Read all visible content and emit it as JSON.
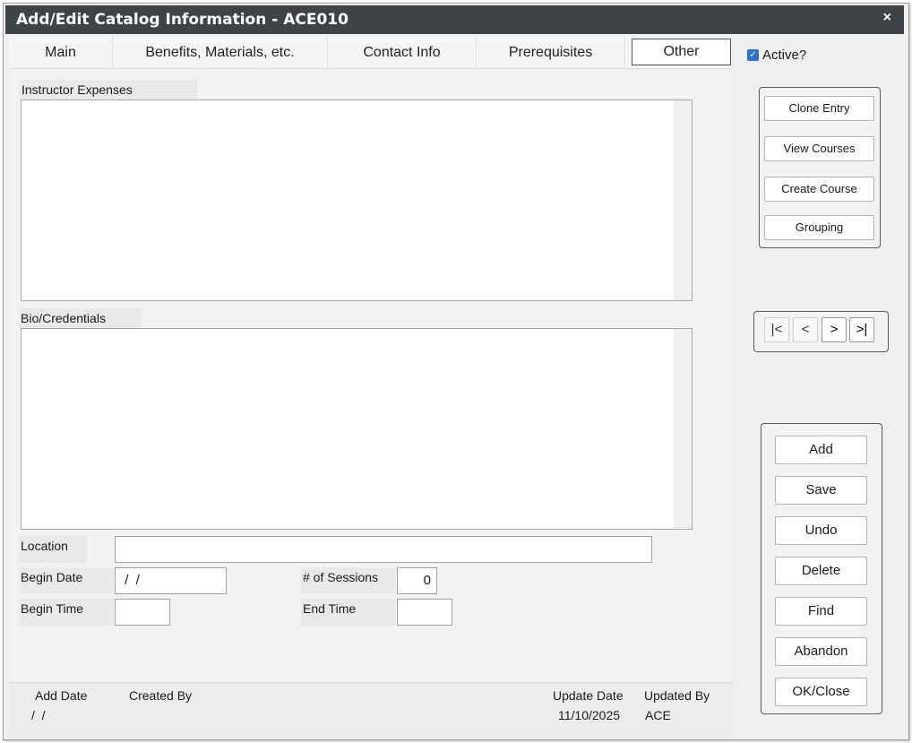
{
  "window": {
    "title": "Add/Edit Catalog Information - ACE010",
    "close_glyph": "×"
  },
  "tabs": [
    {
      "label": "Main"
    },
    {
      "label": "Benefits, Materials, etc."
    },
    {
      "label": "Contact Info"
    },
    {
      "label": "Prerequisites"
    },
    {
      "label": "Other"
    }
  ],
  "active_checkbox": {
    "label": "Active?",
    "checked": true,
    "check_glyph": "✓"
  },
  "fields": {
    "instructor_expenses_label": "Instructor Expenses",
    "bio_credentials_label": "Bio/Credentials",
    "location_label": "Location",
    "location_value": "",
    "begin_date_label": "Begin Date",
    "begin_date_value": " /  /",
    "sessions_label": "# of Sessions",
    "sessions_value": "0",
    "begin_time_label": "Begin Time",
    "begin_time_value": "",
    "end_time_label": "End Time",
    "end_time_value": ""
  },
  "actions_top": {
    "clone_entry": "Clone Entry",
    "view_courses": "View Courses",
    "create_course": "Create Course",
    "grouping": "Grouping"
  },
  "navigation": {
    "first": "|<",
    "prev": "<",
    "next": ">",
    "last": ">|"
  },
  "actions_bottom": {
    "add": "Add",
    "save": "Save",
    "undo": "Undo",
    "delete": "Delete",
    "find": "Find",
    "abandon": "Abandon",
    "ok_close": "OK/Close"
  },
  "footer": {
    "add_date_label": "Add Date",
    "add_date_value": "/  /",
    "created_by_label": "Created By",
    "created_by_value": "",
    "update_date_label": "Update Date",
    "update_date_value": "11/10/2025",
    "updated_by_label": "Updated By",
    "updated_by_value": "ACE"
  },
  "colors": {
    "titlebar": "#3e4347",
    "checkbox_accent": "#2f6fd0",
    "panel_bg": "#efefef"
  }
}
